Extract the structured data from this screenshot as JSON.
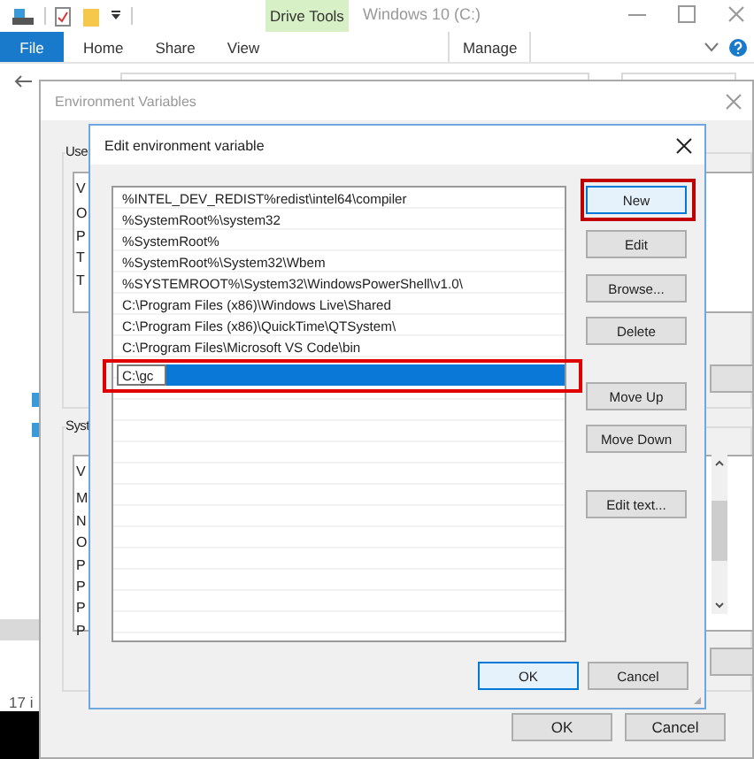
{
  "explorer": {
    "title": "Windows 10 (C:)",
    "context_tab": "Drive Tools",
    "tabs": [
      {
        "label": "File",
        "kind": "file"
      },
      {
        "label": "Home",
        "kind": "tab"
      },
      {
        "label": "Share",
        "kind": "tab"
      },
      {
        "label": "View",
        "kind": "tab"
      },
      {
        "label": "Manage",
        "kind": "context"
      }
    ],
    "status_bar": "17 i"
  },
  "env_dialog": {
    "title": "Environment Variables",
    "user_group": {
      "label": "Use",
      "list_header": "V",
      "rows": [
        "O",
        "P",
        "T",
        "T"
      ]
    },
    "system_group": {
      "label": "Syst",
      "list_header": "V",
      "rows": [
        "M",
        "N",
        "O",
        "P",
        "P",
        "P",
        "P"
      ]
    },
    "buttons": [
      "OK",
      "Cancel"
    ]
  },
  "edit_dialog": {
    "title": "Edit environment variable",
    "entries": [
      "%INTEL_DEV_REDIST%redist\\intel64\\compiler",
      "%SystemRoot%\\system32",
      "%SystemRoot%",
      "%SystemRoot%\\System32\\Wbem",
      "%SYSTEMROOT%\\System32\\WindowsPowerShell\\v1.0\\",
      "C:\\Program Files (x86)\\Windows Live\\Shared",
      "C:\\Program Files (x86)\\QuickTime\\QTSystem\\",
      "C:\\Program Files\\Microsoft VS Code\\bin"
    ],
    "editing": {
      "value": "C:\\gc",
      "highlighted": true
    },
    "side_buttons": [
      {
        "label": "New",
        "highlighted": true,
        "focused": true
      },
      {
        "label": "Edit",
        "highlighted": false,
        "focused": false
      },
      {
        "label": "Browse...",
        "highlighted": false,
        "focused": false
      },
      {
        "label": "Delete",
        "highlighted": false,
        "focused": false
      },
      {
        "label": "Move Up",
        "highlighted": false,
        "focused": false
      },
      {
        "label": "Move Down",
        "highlighted": false,
        "focused": false
      },
      {
        "label": "Edit text...",
        "highlighted": false,
        "focused": false
      }
    ],
    "buttons": [
      {
        "label": "OK",
        "focused": true
      },
      {
        "label": "Cancel",
        "focused": false
      }
    ]
  }
}
